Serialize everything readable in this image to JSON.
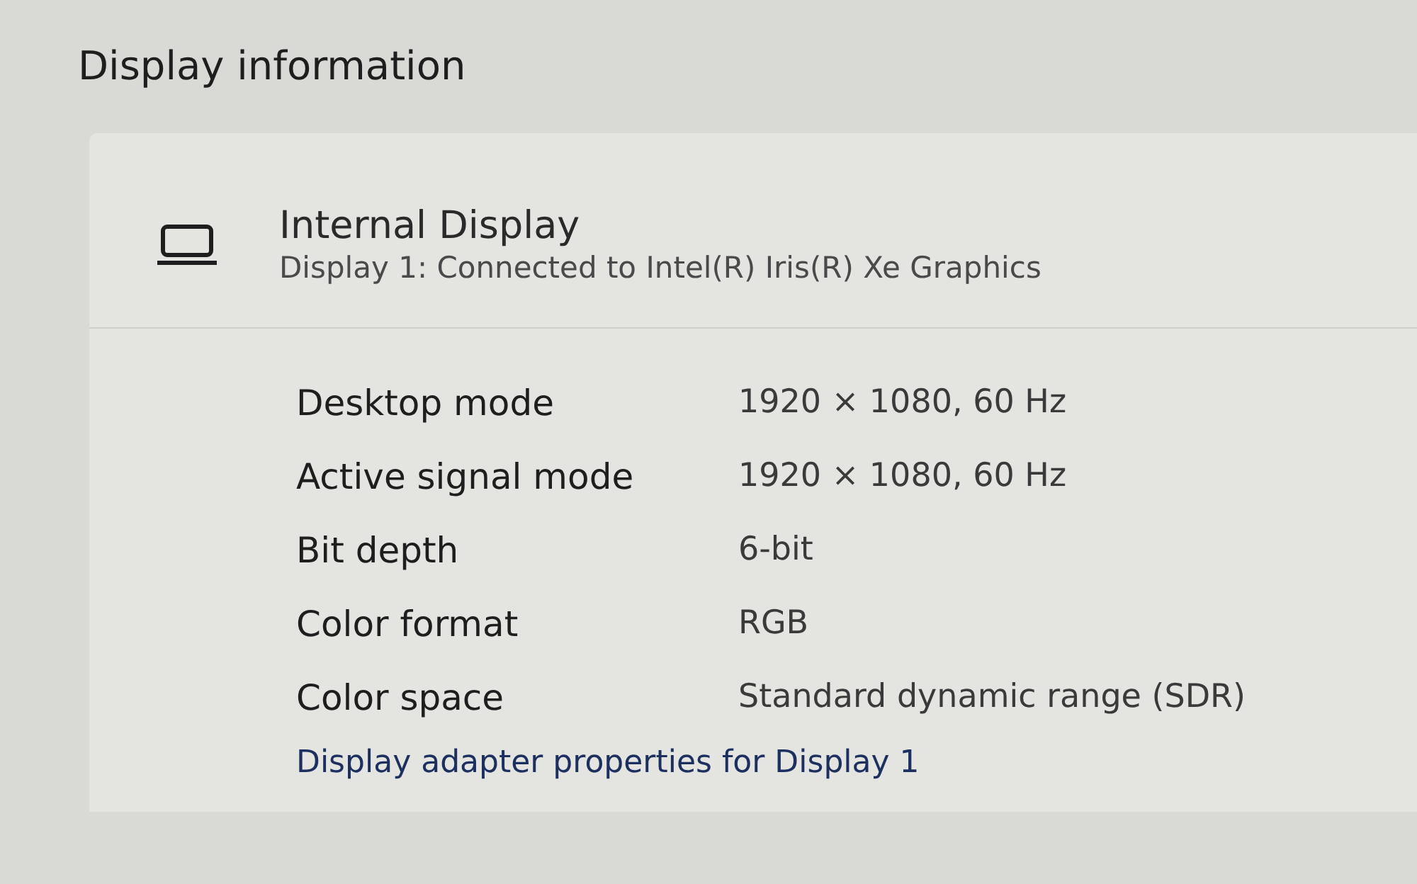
{
  "section_title": "Display information",
  "display": {
    "name": "Internal Display",
    "description": "Display 1: Connected to Intel(R) Iris(R) Xe Graphics"
  },
  "properties": [
    {
      "label": "Desktop mode",
      "value": "1920 × 1080, 60 Hz"
    },
    {
      "label": "Active signal mode",
      "value": "1920 × 1080, 60 Hz"
    },
    {
      "label": "Bit depth",
      "value": "6-bit"
    },
    {
      "label": "Color format",
      "value": "RGB"
    },
    {
      "label": "Color space",
      "value": "Standard dynamic range (SDR)"
    }
  ],
  "adapter_link": "Display adapter properties for Display 1"
}
